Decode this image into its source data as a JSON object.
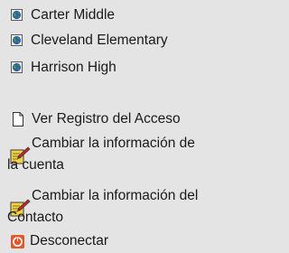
{
  "schools": [
    {
      "label": "Carter Middle",
      "icon": "school-globe-icon"
    },
    {
      "label": "Cleveland Elementary",
      "icon": "school-globe-icon"
    },
    {
      "label": "Harrison High",
      "icon": "school-globe-icon"
    }
  ],
  "actions": {
    "access_log": {
      "label": "Ver Registro del Acceso",
      "icon": "document-icon"
    },
    "account_info": {
      "line1": "Cambiar la información de",
      "line2": "la cuenta",
      "icon": "edit-icon"
    },
    "contact_info": {
      "line1": "Cambiar la información del",
      "line2": "Contacto",
      "icon": "edit-icon"
    },
    "logout": {
      "label": "Desconectar",
      "icon": "power-icon"
    }
  },
  "colors": {
    "background": "#e4e4e4",
    "text": "#1a1a1a",
    "globe_blue": "#2f5fb3",
    "globe_green": "#3e9a3a",
    "edit_yellow": "#f2d14a",
    "edit_pencil_red": "#c6232b",
    "logout_orange": "#e4572e"
  }
}
